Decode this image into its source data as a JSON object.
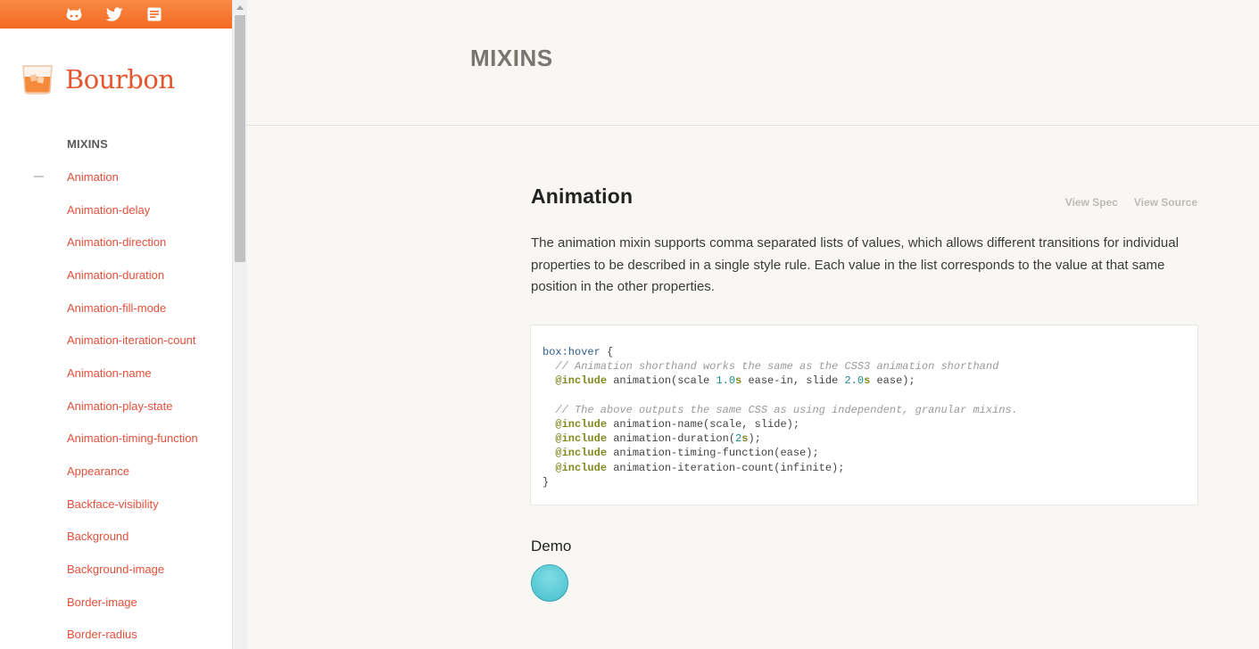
{
  "topbar": {
    "icons": [
      "github-icon",
      "twitter-icon",
      "docs-icon"
    ],
    "background": "#f5762f"
  },
  "brand": {
    "name": "Bourbon",
    "color": "#e4562e"
  },
  "sidebar": {
    "heading": "MIXINS",
    "active_index": 0,
    "items": [
      {
        "label": "Animation"
      },
      {
        "label": "Animation-delay"
      },
      {
        "label": "Animation-direction"
      },
      {
        "label": "Animation-duration"
      },
      {
        "label": "Animation-fill-mode"
      },
      {
        "label": "Animation-iteration-count"
      },
      {
        "label": "Animation-name"
      },
      {
        "label": "Animation-play-state"
      },
      {
        "label": "Animation-timing-function"
      },
      {
        "label": "Appearance"
      },
      {
        "label": "Backface-visibility"
      },
      {
        "label": "Background"
      },
      {
        "label": "Background-image"
      },
      {
        "label": "Border-image"
      },
      {
        "label": "Border-radius"
      }
    ]
  },
  "header": {
    "title": "MIXINS"
  },
  "section": {
    "title": "Animation",
    "view_spec": "View Spec",
    "view_source": "View Source",
    "description": "The animation mixin supports comma separated lists of values, which allows different transitions for individual properties to be described in a single style rule. Each value in the list corresponds to the value at that same position in the other properties."
  },
  "code": {
    "lines": [
      [
        {
          "t": "box:hover",
          "k": "sel"
        },
        {
          "t": " {",
          "k": "plain"
        }
      ],
      [
        {
          "t": "  // Animation shorthand works the same as the CSS3 animation shorthand",
          "k": "com"
        }
      ],
      [
        {
          "t": "  ",
          "k": "plain"
        },
        {
          "t": "@include",
          "k": "kw"
        },
        {
          "t": " animation(scale ",
          "k": "plain"
        },
        {
          "t": "1.0",
          "k": "num"
        },
        {
          "t": "s",
          "k": "kw"
        },
        {
          "t": " ease-in, slide ",
          "k": "plain"
        },
        {
          "t": "2.0",
          "k": "num"
        },
        {
          "t": "s",
          "k": "kw"
        },
        {
          "t": " ease);",
          "k": "plain"
        }
      ],
      [
        {
          "t": "",
          "k": "plain"
        }
      ],
      [
        {
          "t": "  // The above outputs the same CSS as using independent, granular mixins.",
          "k": "com"
        }
      ],
      [
        {
          "t": "  ",
          "k": "plain"
        },
        {
          "t": "@include",
          "k": "kw"
        },
        {
          "t": " animation-name(scale, slide);",
          "k": "plain"
        }
      ],
      [
        {
          "t": "  ",
          "k": "plain"
        },
        {
          "t": "@include",
          "k": "kw"
        },
        {
          "t": " animation-duration(",
          "k": "plain"
        },
        {
          "t": "2",
          "k": "num"
        },
        {
          "t": "s",
          "k": "kw"
        },
        {
          "t": ");",
          "k": "plain"
        }
      ],
      [
        {
          "t": "  ",
          "k": "plain"
        },
        {
          "t": "@include",
          "k": "kw"
        },
        {
          "t": " animation-timing-function(ease);",
          "k": "plain"
        }
      ],
      [
        {
          "t": "  ",
          "k": "plain"
        },
        {
          "t": "@include",
          "k": "kw"
        },
        {
          "t": " animation-iteration-count(infinite);",
          "k": "plain"
        }
      ],
      [
        {
          "t": "}",
          "k": "plain"
        }
      ]
    ]
  },
  "demo": {
    "label": "Demo",
    "circle_color": "#5fcfdb"
  }
}
